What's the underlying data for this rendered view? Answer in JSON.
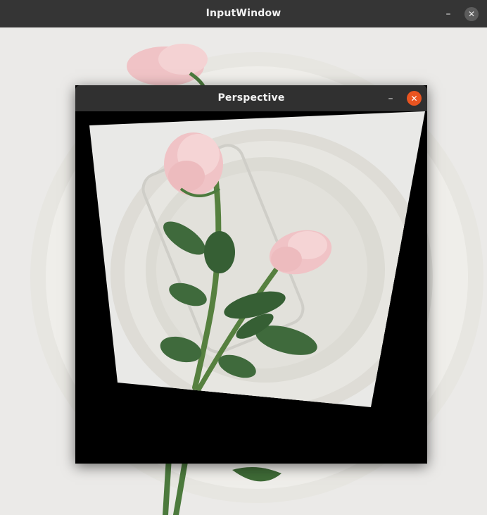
{
  "outer_window": {
    "title": "InputWindow",
    "minimize_glyph": "–",
    "close_glyph": "✕"
  },
  "inner_window": {
    "title": "Perspective",
    "minimize_glyph": "–",
    "close_glyph": "✕"
  },
  "colors": {
    "titlebar": "#353535",
    "close_accent": "#e95420",
    "petal": "#f2c9cc",
    "leaf": "#3f6a3c"
  }
}
